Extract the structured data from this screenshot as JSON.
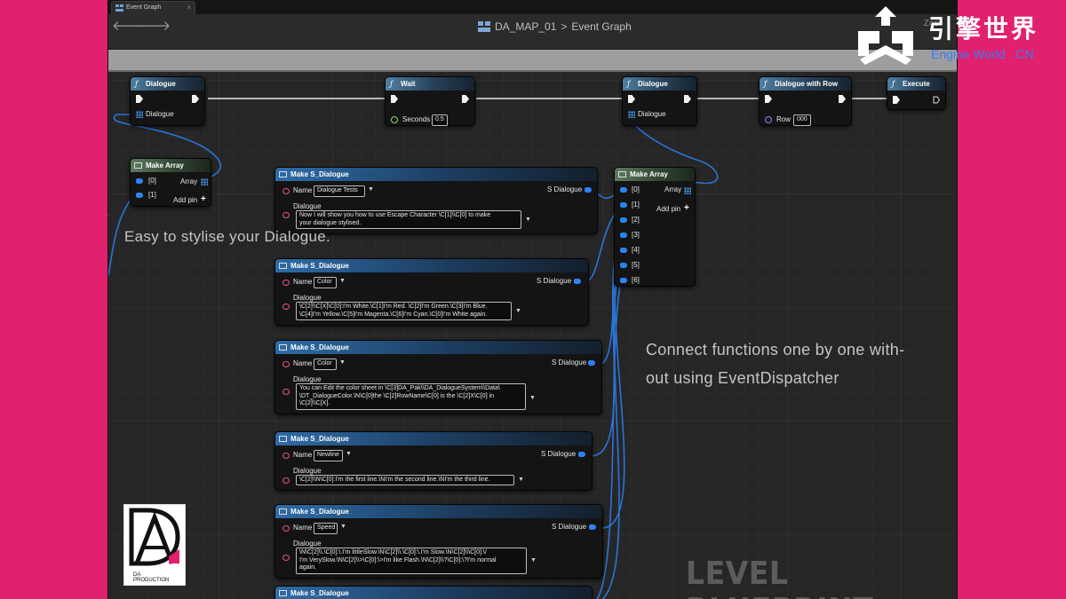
{
  "tab": {
    "label": "Event Graph"
  },
  "toolbar": {
    "back": "🡐",
    "forward": "🡒",
    "breadcrumb_asset": "DA_MAP_01",
    "breadcrumb_sep": ">",
    "breadcrumb_graph": "Event Graph",
    "zoom_text": "Zoo"
  },
  "branding": {
    "cn": "引擎世界",
    "en": "Engine World . CN"
  },
  "overlays": {
    "stylise": "Easy to stylise your Dialogue.",
    "connect_line1": "Connect functions one by one with-",
    "connect_line2": "out using EventDispatcher",
    "level_blueprint": "LEVEL BLUEPRINT"
  },
  "logo": {
    "letters": "DA",
    "text_line1": "DA",
    "text_line2": "PRODUCTION"
  },
  "exec_nodes": [
    {
      "title": "Dialogue",
      "pin_label": "Dialogue"
    },
    {
      "title": "Wait",
      "pin_label": "Seconds",
      "value": "0.5"
    },
    {
      "title": "Dialogue",
      "pin_label": "Dialogue"
    },
    {
      "title": "Dialogue with Row",
      "pin_label": "Row",
      "value": "000"
    },
    {
      "title": "Execute"
    }
  ],
  "make_array_1": {
    "title": "Make Array",
    "pins": [
      "[0]",
      "[1]"
    ],
    "out": "Array",
    "add_pin": "Add pin"
  },
  "make_array_2": {
    "title": "Make Array",
    "pins": [
      "[0]",
      "[1]",
      "[2]",
      "[3]",
      "[4]",
      "[5]",
      "[6]"
    ],
    "out": "Array",
    "add_pin": "Add pin"
  },
  "struct_nodes": [
    {
      "title": "Make S_Dialogue",
      "name_label": "Name",
      "name_value": "Dialogue Tests",
      "out": "S Dialogue",
      "dialogue_label": "Dialogue",
      "dialogue_lines": [
        "Now I will show you how to use Escape Character \\C[1]\\\\C[0] to make",
        "your dialogue stylised."
      ]
    },
    {
      "title": "Make S_Dialogue",
      "name_label": "Name",
      "name_value": "Color",
      "out": "S Dialogue",
      "dialogue_label": "Dialogue",
      "dialogue_lines": [
        "\\C[2]\\\\C[X]\\C[0]:I'm White.\\C[1]I'm Red. \\C[2]I'm Green.\\C[3]I'm Blue.",
        "\\C[4]I'm Yellow.\\C[5]I'm Magenta.\\C[6]I'm Cyan.\\C[0]I'm White again."
      ]
    },
    {
      "title": "Make S_Dialogue",
      "name_label": "Name",
      "name_value": "Color",
      "out": "S Dialogue",
      "dialogue_label": "Dialogue",
      "dialogue_lines": [
        "You can Edit the color sheet in \\C[3]DA_Pak\\\\DA_DialogueSystem\\\\Data\\",
        "\\DT_DialogueColor.\\N\\C[0]the \\C[2]RowName\\C[0] is the \\C[2]X\\C[0] in",
        "\\C[2]\\\\C[X]."
      ]
    },
    {
      "title": "Make S_Dialogue",
      "name_label": "Name",
      "name_value": "Newline",
      "out": "S Dialogue",
      "dialogue_label": "Dialogue",
      "dialogue_lines": [
        "\\C[2]\\\\N\\C[0]:I'm the first line.\\NI'm the second line.\\NI'm the third line."
      ]
    },
    {
      "title": "Make S_Dialogue",
      "name_label": "Name",
      "name_value": "Speed",
      "out": "S Dialogue",
      "dialogue_label": "Dialogue",
      "dialogue_lines": [
        "\\N\\C[2]\\\\.\\C[0]:\\.I'm littleSlow.\\N\\C[2]\\\\.\\C[0]:\\.I'm Slow.\\N\\C[2]\\\\\\C[0]:\\/",
        "I'm VerySlow.\\N\\C[2]\\\\>\\C[0]:\\>I'm like Flash.\\N\\C[2]\\\\?\\C[0]:\\?I'm normal",
        "again."
      ]
    },
    {
      "title": "Make S_Dialogue"
    }
  ]
}
